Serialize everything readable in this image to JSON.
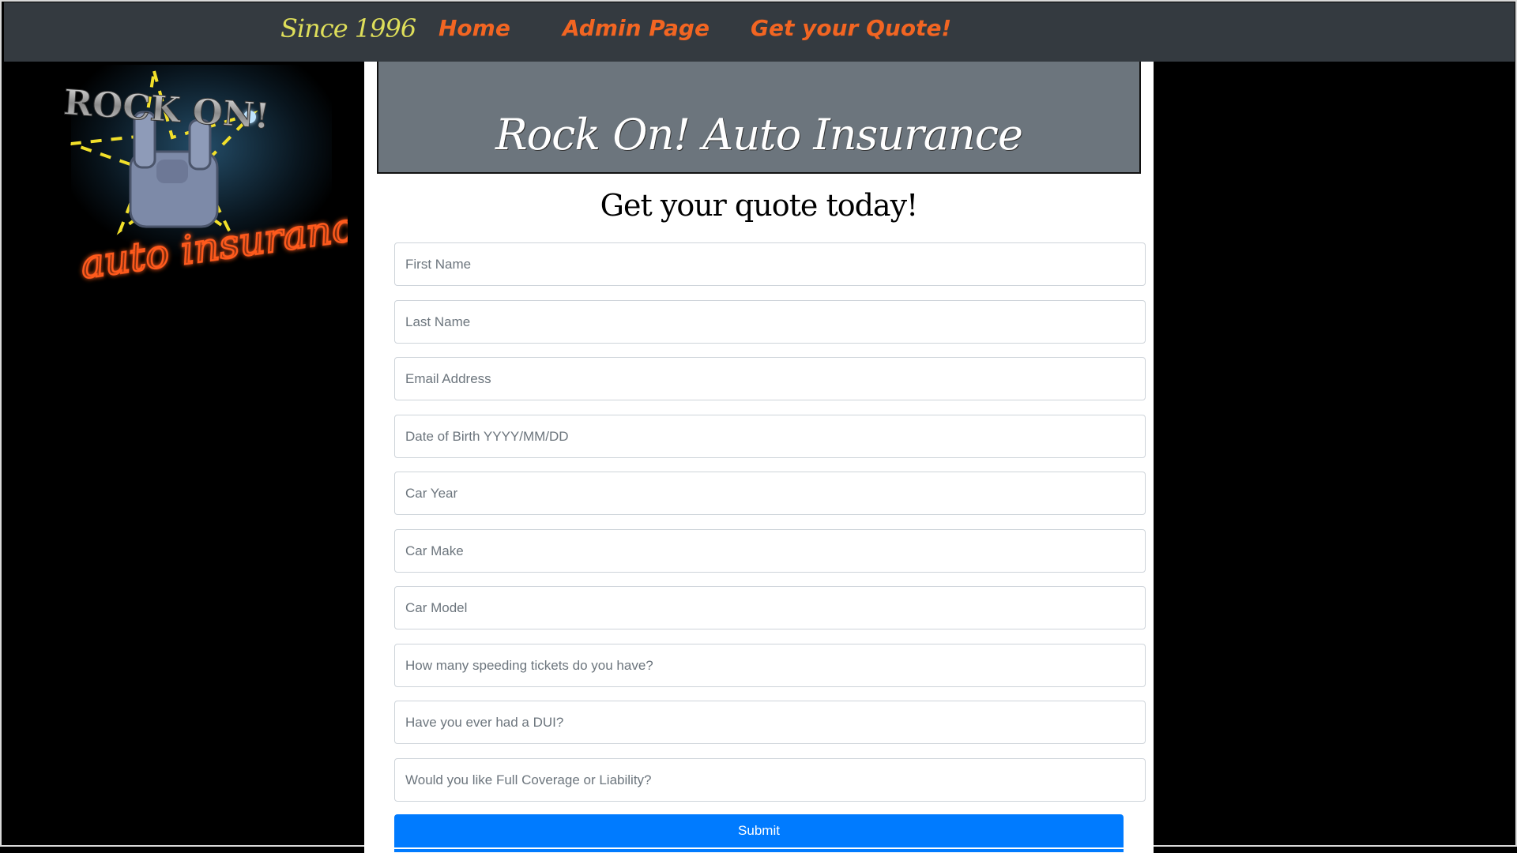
{
  "nav": {
    "brand": "Since 1996",
    "links": [
      {
        "label": "Home"
      },
      {
        "label": "Admin Page"
      },
      {
        "label": "Get your Quote!"
      }
    ],
    "brand_color": "#dede5a",
    "link_color": "#f26522"
  },
  "logo": {
    "top_text": "ROCK ON!",
    "bottom_text": "auto insurance"
  },
  "jumbotron": {
    "title": "Rock On! Auto Insurance"
  },
  "form": {
    "heading": "Get your quote today!",
    "fields": [
      {
        "placeholder": "First Name",
        "value": ""
      },
      {
        "placeholder": "Last Name",
        "value": ""
      },
      {
        "placeholder": "Email Address",
        "value": ""
      },
      {
        "placeholder": "Date of Birth YYYY/MM/DD",
        "value": ""
      },
      {
        "placeholder": "Car Year",
        "value": ""
      },
      {
        "placeholder": "Car Make",
        "value": ""
      },
      {
        "placeholder": "Car Model",
        "value": ""
      },
      {
        "placeholder": "How many speeding tickets do you have?",
        "value": ""
      },
      {
        "placeholder": "Have you ever had a DUI?",
        "value": ""
      },
      {
        "placeholder": "Would you like Full Coverage or Liability?",
        "value": ""
      }
    ],
    "submit_label": "Submit",
    "submit_color": "#007bff"
  }
}
